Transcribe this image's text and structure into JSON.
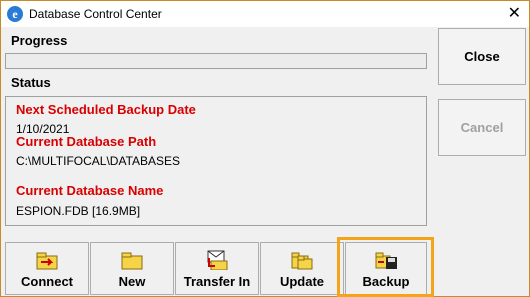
{
  "window": {
    "title": "Database Control Center",
    "close_glyph": "✕",
    "app_icon_glyph": "e"
  },
  "progress": {
    "label": "Progress",
    "value": 0
  },
  "status": {
    "label": "Status",
    "next_backup_heading": "Next Scheduled Backup Date",
    "next_backup_value": "1/10/2021",
    "db_path_heading": "Current Database Path",
    "db_path_value": "C:\\MULTIFOCAL\\DATABASES",
    "db_name_heading": "Current Database Name",
    "db_name_value": "ESPION.FDB [16.9MB]"
  },
  "side_buttons": {
    "close": "Close",
    "cancel": "Cancel"
  },
  "toolbar": {
    "connect": "Connect",
    "new": "New",
    "transfer_in": "Transfer In",
    "update": "Update",
    "backup": "Backup"
  },
  "colors": {
    "heading_red": "#d80000",
    "highlight": "#f4a418",
    "folder": "#f5d547"
  },
  "icons": [
    "connect-icon",
    "new-folder-icon",
    "transfer-in-icon",
    "update-icon",
    "backup-icon"
  ]
}
